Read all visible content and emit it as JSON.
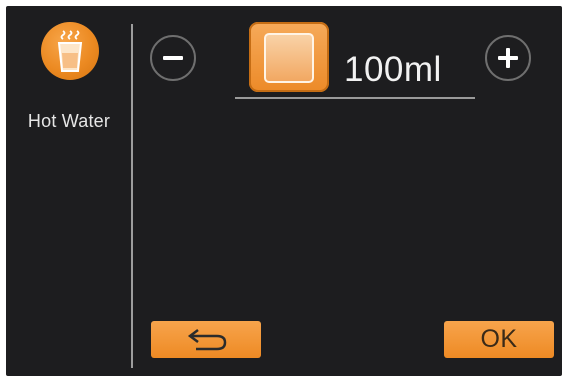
{
  "sidebar": {
    "items": [
      {
        "label": "Hot Water",
        "icon": "hot-water-cup-icon",
        "selected": true
      }
    ]
  },
  "volume": {
    "value": "100ml",
    "decrease_icon": "minus-icon",
    "increase_icon": "plus-icon",
    "cup_icon": "cup-size-icon"
  },
  "actions": {
    "back_icon": "back-arrow-icon",
    "ok_label": "OK"
  },
  "colors": {
    "background": "#1d1d1f",
    "accent": "#ee8a24",
    "text": "#f2f2f2",
    "divider": "#9d9d9d"
  }
}
